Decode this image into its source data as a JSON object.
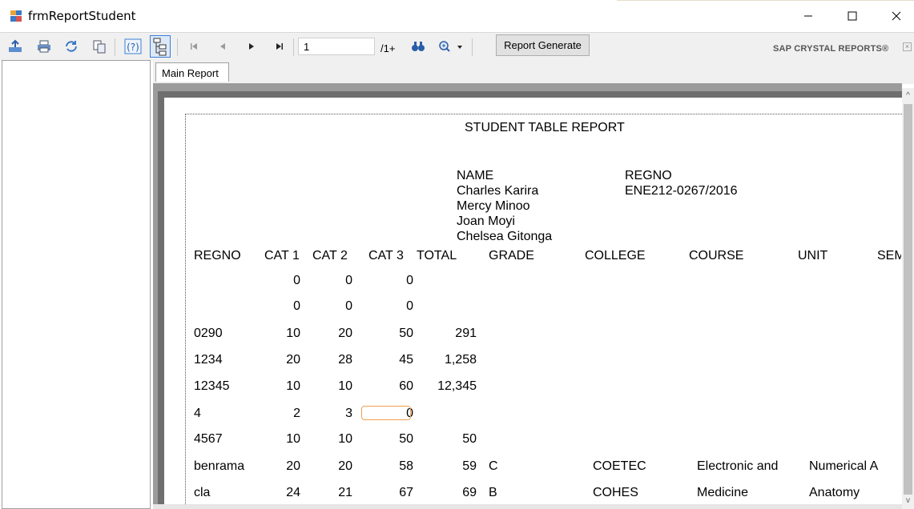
{
  "window": {
    "title": "frmReportStudent"
  },
  "toolbar": {
    "icons": [
      "export-icon",
      "print-icon",
      "refresh-icon",
      "copy-icon",
      "help-icon",
      "group-tree-toggle-icon",
      "first-page-icon",
      "previous-page-icon",
      "next-page-icon",
      "last-page-icon",
      "find-icon",
      "zoom-icon"
    ],
    "page_value": "1",
    "page_total": "/1+",
    "report_generate_label": "Report Generate",
    "brand": "SAP CRYSTAL REPORTS®"
  },
  "tabs": [
    {
      "label": "Main Report"
    }
  ],
  "report": {
    "title": "STUDENT TABLE REPORT",
    "name_header": "NAME",
    "names": [
      "Charles Karira",
      "Mercy Minoo",
      "Joan Moyi",
      "Chelsea Gitonga"
    ],
    "regno_header": "REGNO",
    "regno_value": "ENE212-0267/2016",
    "columns": [
      "REGNO",
      "CAT 1",
      "CAT 2",
      "CAT 3",
      "TOTAL",
      "GRADE",
      "COLLEGE",
      "COURSE",
      "UNIT",
      "SEM"
    ],
    "rows": [
      {
        "regno": "",
        "cat1": "0",
        "cat2": "0",
        "cat3": "0",
        "total": "",
        "grade": "",
        "college": "",
        "course": "",
        "unit": ""
      },
      {
        "regno": "",
        "cat1": "0",
        "cat2": "0",
        "cat3": "0",
        "total": "",
        "grade": "",
        "college": "",
        "course": "",
        "unit": ""
      },
      {
        "regno": "0290",
        "cat1": "10",
        "cat2": "20",
        "cat3": "50",
        "total": "291",
        "grade": "",
        "college": "",
        "course": "",
        "unit": ""
      },
      {
        "regno": "1234",
        "cat1": "20",
        "cat2": "28",
        "cat3": "45",
        "total": "1,258",
        "grade": "",
        "college": "",
        "course": "",
        "unit": ""
      },
      {
        "regno": "12345",
        "cat1": "10",
        "cat2": "10",
        "cat3": "60",
        "total": "12,345",
        "grade": "",
        "college": "",
        "course": "",
        "unit": ""
      },
      {
        "regno": "4",
        "cat1": "2",
        "cat2": "3",
        "cat3": "0",
        "total": "",
        "grade": "",
        "college": "",
        "course": "",
        "unit": ""
      },
      {
        "regno": "4567",
        "cat1": "10",
        "cat2": "10",
        "cat3": "50",
        "total": "50",
        "grade": "",
        "college": "",
        "course": "",
        "unit": ""
      },
      {
        "regno": "benrama",
        "cat1": "20",
        "cat2": "20",
        "cat3": "58",
        "total": "59",
        "grade": "C",
        "college": "COETEC",
        "course": "Electronic and",
        "unit": "Numerical A"
      },
      {
        "regno": "cla",
        "cat1": "24",
        "cat2": "21",
        "cat3": "67",
        "total": "69",
        "grade": "B",
        "college": "COHES",
        "course": "Medicine",
        "unit": "Anatomy"
      }
    ]
  }
}
